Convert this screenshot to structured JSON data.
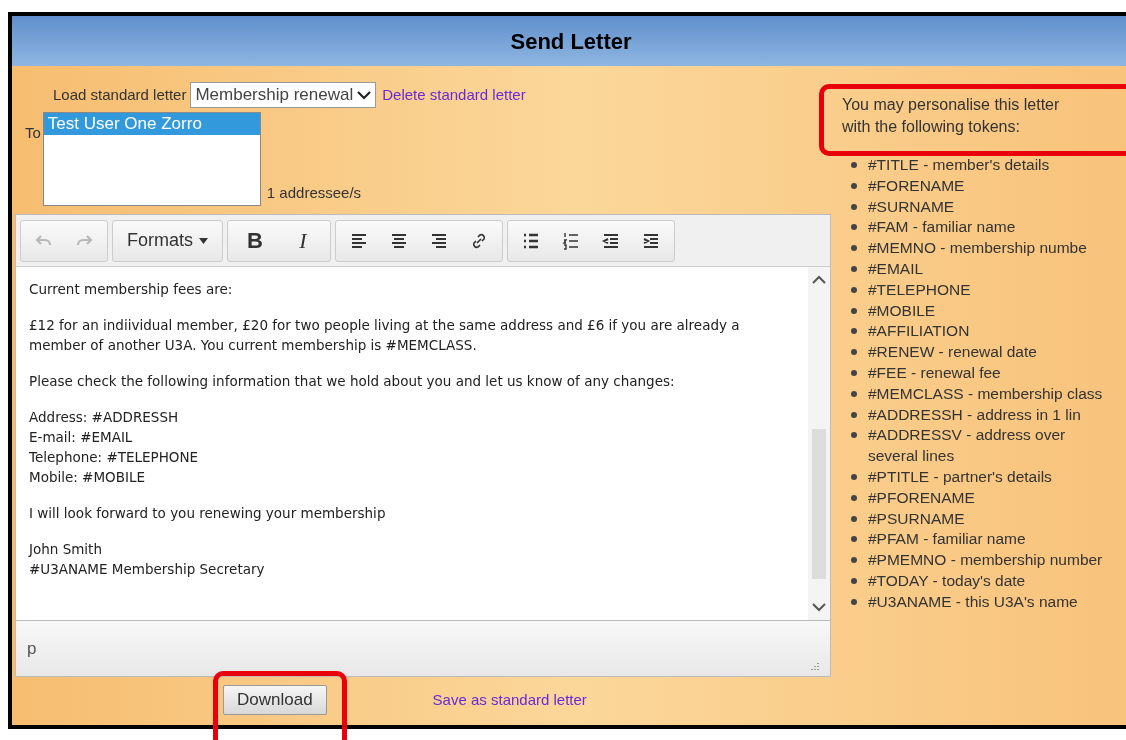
{
  "window": {
    "title": "Send Letter"
  },
  "load_standard_letter": {
    "label": "Load standard letter",
    "value": "Membership renewal",
    "delete_link": "Delete standard letter"
  },
  "to": {
    "label": "To",
    "recipients": [
      {
        "name": "Test User One Zorro",
        "selected": true
      }
    ],
    "count": "1 addressee/s"
  },
  "toolbar": [
    [
      {
        "kind": "icon",
        "disabled": true
      },
      {
        "kind": "icon",
        "disabled": true
      }
    ],
    [
      {
        "kind": "dropdown",
        "label": "Formats",
        "disabled": false
      }
    ],
    [
      {
        "kind": "text",
        "label": "B",
        "disabled": false
      },
      {
        "kind": "text",
        "label": "I",
        "disabled": false
      }
    ],
    [
      {
        "kind": "icon",
        "disabled": false
      },
      {
        "kind": "icon",
        "disabled": false
      },
      {
        "kind": "icon",
        "disabled": false
      },
      {
        "kind": "icon",
        "disabled": false
      }
    ],
    [
      {
        "kind": "icon",
        "disabled": false
      },
      {
        "kind": "icon",
        "disabled": false
      },
      {
        "kind": "icon",
        "disabled": false
      },
      {
        "kind": "icon",
        "disabled": false
      }
    ]
  ],
  "editor": {
    "paragraphs": [
      [
        "Current membership fees are:"
      ],
      [
        "£12 for an indiividual member, £20 for two people living at the same address and £6 if you are already a member of another U3A. You current membership is #MEMCLASS."
      ],
      [
        "Please check the following information that we hold about you and let us know of any changes:"
      ],
      [
        "Address: #ADDRESSH",
        "E-mail: #EMAIL",
        "Telephone: #TELEPHONE",
        "Mobile: #MOBILE"
      ],
      [
        "I will look forward to you renewing your membership"
      ],
      [
        "John Smith",
        "#U3ANAME Membership Secretary"
      ]
    ],
    "path": "p"
  },
  "download_button": "Download",
  "save_link": "Save as standard letter",
  "tokens": {
    "intro": "You may personalise this letter with the following tokens:",
    "items": [
      "#TITLE - member's details",
      "#FORENAME",
      "#SURNAME",
      "#FAM - familiar name",
      "#MEMNO - membership numbe",
      "#EMAIL",
      "#TELEPHONE",
      "#MOBILE",
      "#AFFILIATION",
      "#RENEW - renewal date",
      "#FEE - renewal fee",
      "#MEMCLASS - membership class",
      "#ADDRESSH - address in 1 lin",
      "#ADDRESSV - address over several lines",
      "#PTITLE - partner's details",
      "#PFORENAME",
      "#PSURNAME",
      "#PFAM - familiar name",
      "#PMEMNO - membership number",
      "#TODAY - today's date",
      "#U3ANAME - this U3A's name"
    ]
  }
}
